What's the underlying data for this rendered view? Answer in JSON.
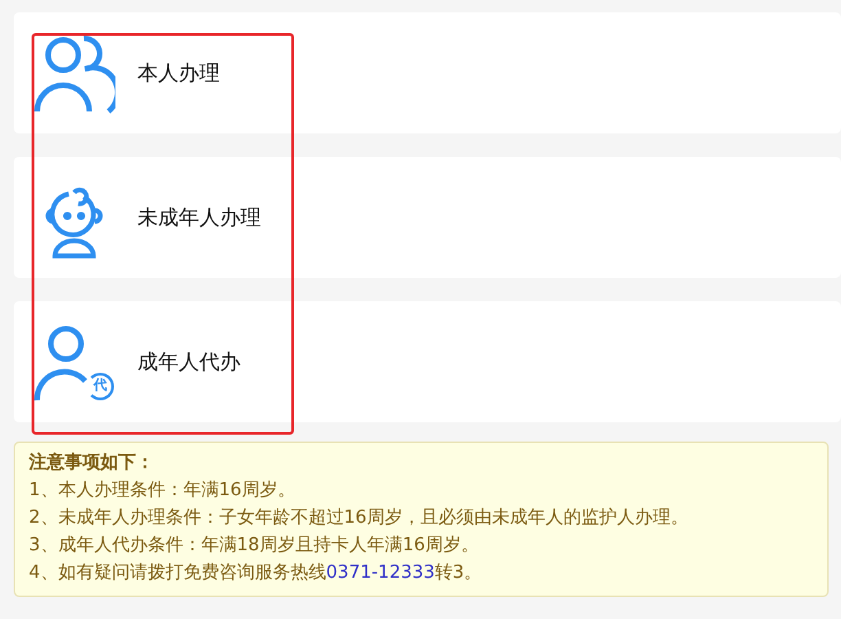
{
  "options": [
    {
      "kind": "self",
      "label": "本人办理"
    },
    {
      "kind": "minor",
      "label": "未成年人办理"
    },
    {
      "kind": "proxy",
      "label": "成年人代办",
      "badge": "代"
    }
  ],
  "notice": {
    "title": "注意事项如下：",
    "lines": [
      {
        "text": "1、本人办理条件：年满16周岁。"
      },
      {
        "text": "2、未成年人办理条件：子女年龄不超过16周岁，且必须由未成年人的监护人办理。"
      },
      {
        "text": "3、成年人代办条件：年满18周岁且持卡人年满16周岁。"
      },
      {
        "text": "4、如有疑问请拨打免费咨询服务热线",
        "link": "0371-12333",
        "suffix": "转3。"
      }
    ]
  }
}
